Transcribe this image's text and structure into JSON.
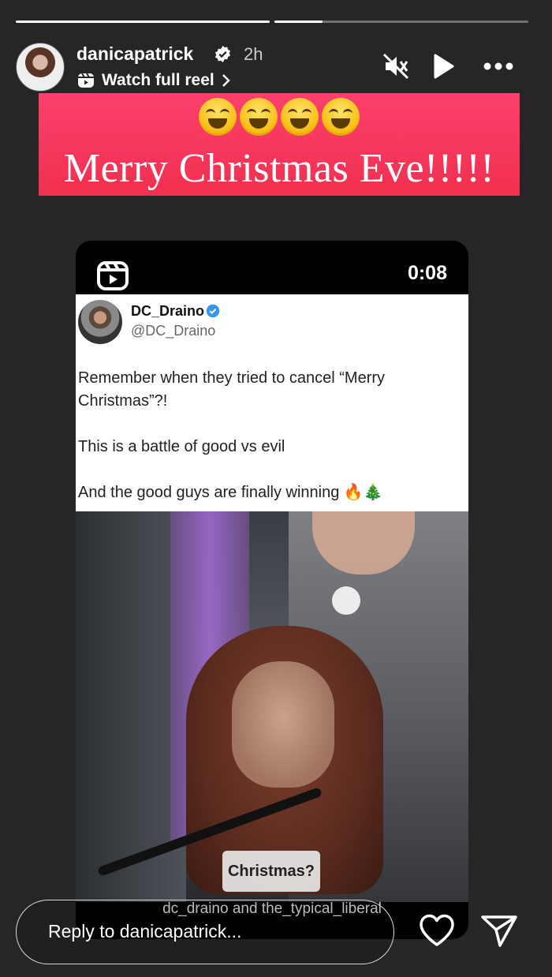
{
  "progress": {
    "segments": 2,
    "active_index": 1,
    "active_fraction": 0.19
  },
  "header": {
    "username": "danicapatrick",
    "time": "2h",
    "watch_label": "Watch full reel",
    "icons": [
      "verified-badge-icon",
      "muted-speaker-icon",
      "play-icon",
      "more-options-icon",
      "reel-icon",
      "chevron-right-icon"
    ]
  },
  "banner": {
    "emoji_count": 4,
    "emoji": "laughing-face-emoji",
    "text": "Merry Christmas Eve!!!!!"
  },
  "reel": {
    "timer": "0:08",
    "tweet": {
      "name": "DC_Draino",
      "handle": "@DC_Draino",
      "lines": [
        "Remember when they tried to cancel “Merry Christmas”?!",
        "This is a battle of good vs evil",
        "And the good guys are finally winning 🔥🎄"
      ]
    },
    "video_caption": "Christmas?",
    "credit": "dc_draino and the_typical_liberal"
  },
  "footer": {
    "reply_placeholder": "Reply to danicapatrick...",
    "icons": [
      "heart-icon",
      "send-icon"
    ]
  },
  "colors": {
    "background": "#262626",
    "banner": "#f2304f",
    "accent": "#ffffff",
    "verified": "#3897f0"
  }
}
